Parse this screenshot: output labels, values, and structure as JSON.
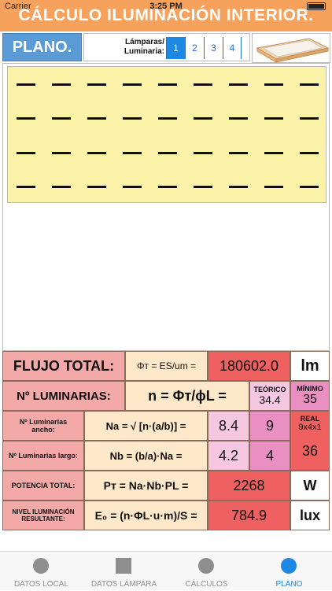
{
  "status": {
    "carrier": "Carrier",
    "time": "3:25 PM"
  },
  "header": {
    "title": "CÁLCULO ILUMINACIÓN INTERIOR."
  },
  "plan": {
    "tab_label": "PLANO.",
    "lamps_label_line1": "Lámparas/",
    "lamps_label_line2": "Luminaria:",
    "lamp_options": [
      "1",
      "2",
      "3",
      "4"
    ],
    "selected": "1",
    "grid_rows": 4,
    "grid_cols": 9
  },
  "results": {
    "flux_label": "FLUJO TOTAL:",
    "flux_formula": "Φт = ES/um =",
    "flux_value": "180602.0",
    "flux_unit": "lm",
    "lum_label": "Nº LUMINARIAS:",
    "lum_formula": "n = Φт/ϕL =",
    "teorico_label": "TEÓRICO",
    "teorico_value": "34.4",
    "minimo_label": "MÍNIMO",
    "minimo_value": "35",
    "ancho_label": "Nº Luminarias ancho:",
    "ancho_formula": "Na = √ [n·(a/b)] =",
    "ancho_value1": "8.4",
    "ancho_value2": "9",
    "real_label": "REAL",
    "real_detail": "9x4x1",
    "largo_label": "Nº Luminarias largo:",
    "largo_formula": "Nb = (b/a)·Na =",
    "largo_value1": "4.2",
    "largo_value2": "4",
    "real_value": "36",
    "power_label": "POTENCIA TOTAL:",
    "power_formula": "Pт = Na·Nb·PL =",
    "power_value": "2268",
    "power_unit": "W",
    "level_label": "NIVEL ILUMINACIÓN RESULTANTE:",
    "level_formula": "E₀ = (n·ΦL·u·m)/S =",
    "level_value": "784.9",
    "level_unit": "lux"
  },
  "tabbar": {
    "items": [
      {
        "label": "DATOS LOCAL",
        "icon": "circle-icon"
      },
      {
        "label": "DATOS LÁMPARA",
        "icon": "square-icon"
      },
      {
        "label": "CÁLCULOS",
        "icon": "circle-icon"
      },
      {
        "label": "PLANO",
        "icon": "circle-icon"
      }
    ],
    "active_index": 3,
    "active_color": "#1e88e5",
    "inactive_color": "#8e8e8e"
  }
}
